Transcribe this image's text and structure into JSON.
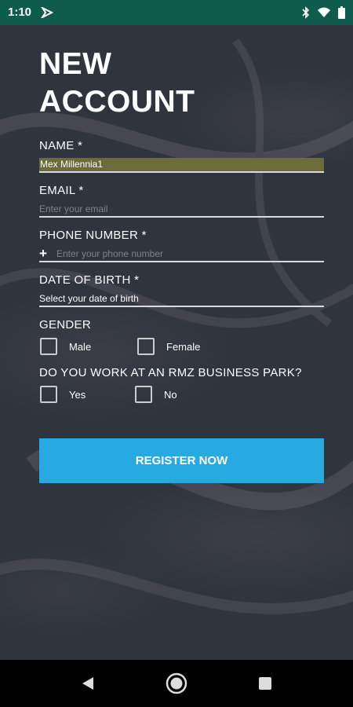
{
  "status_bar": {
    "time": "1:10",
    "icons": [
      "app-notification-icon",
      "bluetooth-icon",
      "wifi-icon",
      "battery-icon"
    ]
  },
  "form": {
    "title_line1": "NEW",
    "title_line2": "ACCOUNT",
    "name": {
      "label": "NAME *",
      "value": "Mex Millennia1"
    },
    "email": {
      "label": "EMAIL *",
      "placeholder": "Enter your email"
    },
    "phone": {
      "label": "PHONE NUMBER *",
      "prefix": "+",
      "placeholder": "Enter your phone number"
    },
    "dob": {
      "label": "DATE OF BIRTH *",
      "value": "Select your date of birth"
    },
    "gender": {
      "label": "GENDER",
      "options": [
        "Male",
        "Female"
      ]
    },
    "rmz": {
      "label": "DO YOU WORK AT AN RMZ BUSINESS PARK?",
      "options": [
        "Yes",
        "No"
      ]
    },
    "register_label": "REGISTER NOW"
  },
  "colors": {
    "status_bar": "#0f5c4e",
    "background": "#2f343d",
    "button": "#27a9e1",
    "name_highlight": "#6c6b3c"
  }
}
